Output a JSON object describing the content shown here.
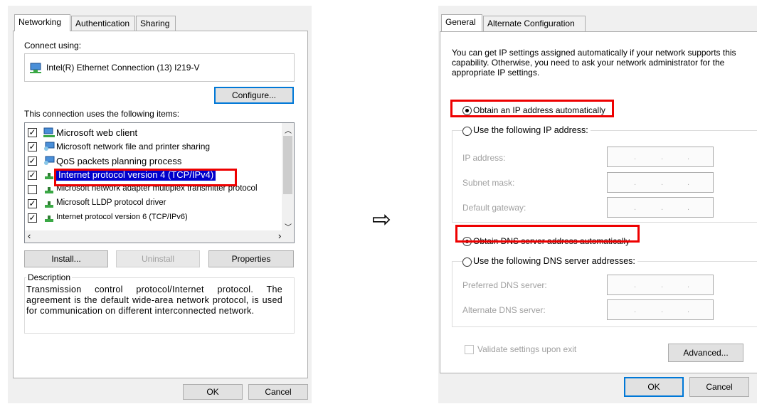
{
  "left_dialog": {
    "tabs": [
      "Networking",
      "Authentication",
      "Sharing"
    ],
    "connect_using_label": "Connect using:",
    "adapter_name": "Intel(R) Ethernet Connection (13) I219-V",
    "configure_button": "Configure...",
    "items_label": "This connection uses the following items:",
    "items": [
      {
        "label": "Microsoft web client",
        "checked": true
      },
      {
        "label": "Microsoft network file and printer sharing",
        "checked": true
      },
      {
        "label": "QoS packets planning process",
        "checked": true
      },
      {
        "label": "Internet protocol version 4 (TCP/IPv4)",
        "checked": true,
        "selected": true
      },
      {
        "label": "Microsoft network adapter multiplex transmitter protocol",
        "checked": false
      },
      {
        "label": "Microsoft LLDP protocol driver",
        "checked": true
      },
      {
        "label": "Internet protocol version 6 (TCP/IPv6)",
        "checked": true
      }
    ],
    "install_button": "Install...",
    "uninstall_button": "Uninstall",
    "properties_button": "Properties",
    "description_label": "Description",
    "description_text": "Transmission control protocol/Internet protocol. The agreement is the default wide-area network protocol, is used for communication on different interconnected network.",
    "ok_button": "OK",
    "cancel_button": "Cancel"
  },
  "arrow_glyph": "⇨",
  "right_dialog": {
    "tabs": [
      "General",
      "Alternate Configuration"
    ],
    "intro_text": "You can get IP settings assigned automatically if your network supports this capability. Otherwise, you need to ask your network administrator for the appropriate IP settings.",
    "obtain_ip_auto": "Obtain an IP address automatically",
    "use_following_ip": "Use the following IP address:",
    "ip_address_label": "IP address:",
    "subnet_mask_label": "Subnet mask:",
    "default_gateway_label": "Default gateway:",
    "obtain_dns_auto": "Obtain DNS server address automatically",
    "use_following_dns": "Use the following DNS server addresses:",
    "preferred_dns_label": "Preferred DNS server:",
    "alternate_dns_label": "Alternate DNS server:",
    "ip_dots": ".",
    "validate_label": "Validate settings upon exit",
    "advanced_button": "Advanced...",
    "ok_button": "OK",
    "cancel_button": "Cancel",
    "selected_ip_option": "automatic",
    "selected_dns_option": "automatic"
  },
  "colors": {
    "highlight": "#0000cc",
    "callout_red": "#ee0000",
    "focus_blue": "#0078d7"
  }
}
